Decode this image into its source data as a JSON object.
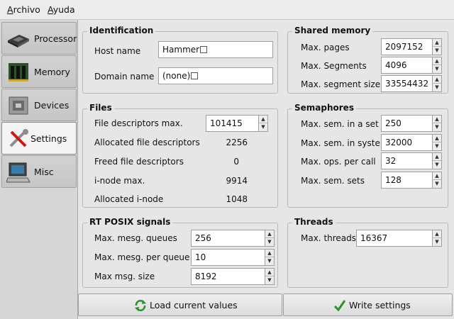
{
  "menu": {
    "archivo": {
      "first": "A",
      "rest": "rchivo"
    },
    "ayuda": {
      "first": "A",
      "rest": "yuda"
    }
  },
  "sidebar": {
    "items": [
      {
        "label": "Processor"
      },
      {
        "label": "Memory"
      },
      {
        "label": "Devices"
      },
      {
        "label": "Settings"
      },
      {
        "label": "Misc"
      }
    ]
  },
  "identification": {
    "title": "Identification",
    "host_label": "Host name",
    "host_value": "Hammer",
    "domain_label": "Domain name",
    "domain_value": "(none)"
  },
  "files": {
    "title": "Files",
    "max_label": "File descriptors max.",
    "max_value": "101415",
    "allocated_label": "Allocated file descriptors",
    "allocated_value": "2256",
    "freed_label": "Freed file descriptors",
    "freed_value": "0",
    "inode_max_label": "i-node max.",
    "inode_max_value": "9914",
    "inode_alloc_label": "Allocated i-node",
    "inode_alloc_value": "1048"
  },
  "rt_posix": {
    "title": "RT POSIX signals",
    "queues_label": "Max. mesg. queues",
    "queues_value": "256",
    "per_queue_label": "Max. mesg. per queue",
    "per_queue_value": "10",
    "size_label": "Max msg. size",
    "size_value": "8192"
  },
  "shared_memory": {
    "title": "Shared memory",
    "pages_label": "Max. pages",
    "pages_value": "2097152",
    "segments_label": "Max. Segments",
    "segments_value": "4096",
    "segsize_label": "Max. segment size",
    "segsize_value": "33554432"
  },
  "semaphores": {
    "title": "Semaphores",
    "set_label": "Max. sem. in a set",
    "set_value": "250",
    "system_label": "Max. sem. in system",
    "system_value": "32000",
    "ops_label": "Max. ops. per call",
    "ops_value": "32",
    "sets_label": "Max. sem. sets",
    "sets_value": "128"
  },
  "threads": {
    "title": "Threads",
    "max_label": "Max. threads",
    "max_value": "16367"
  },
  "buttons": {
    "load": "Load current values",
    "write": "Write settings"
  },
  "icons": {
    "refresh": "refresh-icon",
    "check": "check-icon"
  }
}
